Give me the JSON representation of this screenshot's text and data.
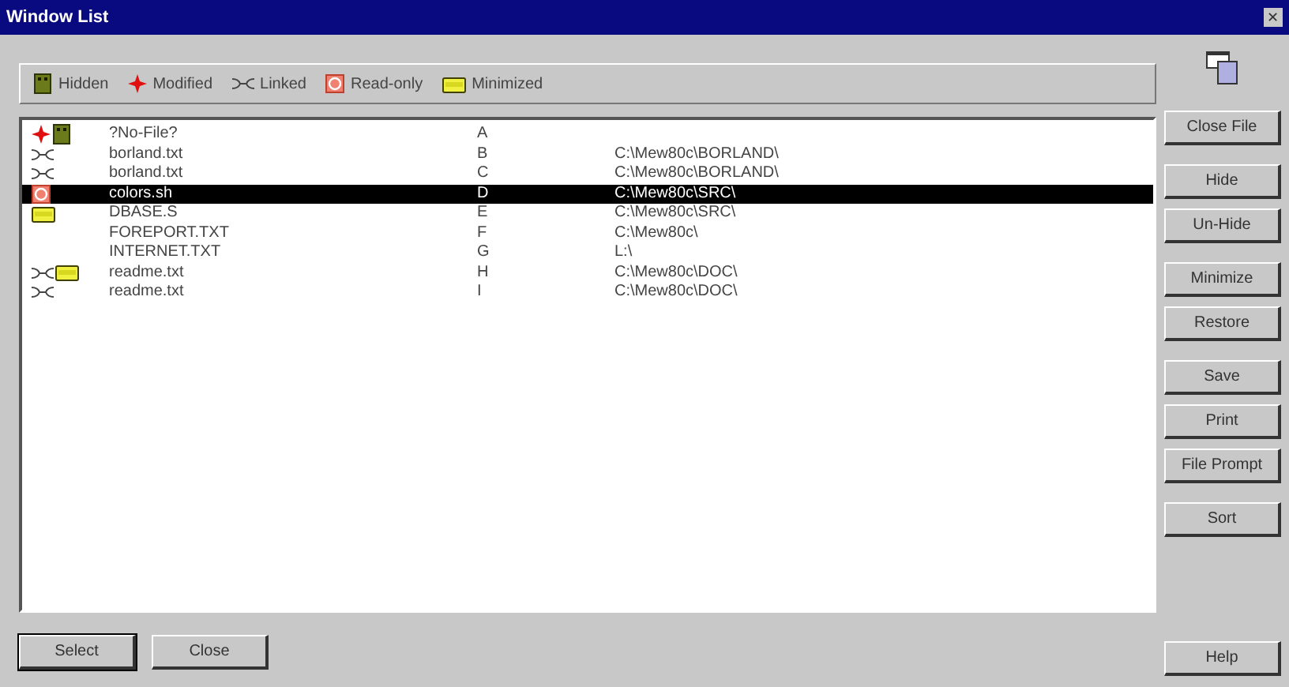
{
  "window": {
    "title": "Window List",
    "close_glyph": "✕"
  },
  "legend": [
    {
      "kind": "hidden",
      "label": "Hidden"
    },
    {
      "kind": "modified",
      "label": "Modified"
    },
    {
      "kind": "linked",
      "label": "Linked"
    },
    {
      "kind": "readonly",
      "label": "Read-only"
    },
    {
      "kind": "minimized",
      "label": "Minimized"
    }
  ],
  "rows": [
    {
      "modified": true,
      "hidden": true,
      "linked": false,
      "readonly": false,
      "minimized": false,
      "name": "?No-File?",
      "letter": "A",
      "path": "",
      "selected": false
    },
    {
      "modified": false,
      "hidden": false,
      "linked": true,
      "readonly": false,
      "minimized": false,
      "name": "borland.txt",
      "letter": "B",
      "path": "C:\\Mew80c\\BORLAND\\",
      "selected": false
    },
    {
      "modified": false,
      "hidden": false,
      "linked": true,
      "readonly": false,
      "minimized": false,
      "name": "borland.txt",
      "letter": "C",
      "path": "C:\\Mew80c\\BORLAND\\",
      "selected": false
    },
    {
      "modified": false,
      "hidden": false,
      "linked": false,
      "readonly": true,
      "minimized": false,
      "name": "colors.sh",
      "letter": "D",
      "path": "C:\\Mew80c\\SRC\\",
      "selected": true
    },
    {
      "modified": false,
      "hidden": false,
      "linked": false,
      "readonly": false,
      "minimized": true,
      "name": "DBASE.S",
      "letter": "E",
      "path": "C:\\Mew80c\\SRC\\",
      "selected": false
    },
    {
      "modified": false,
      "hidden": false,
      "linked": false,
      "readonly": false,
      "minimized": false,
      "name": "FOREPORT.TXT",
      "letter": "F",
      "path": "C:\\Mew80c\\",
      "selected": false
    },
    {
      "modified": false,
      "hidden": false,
      "linked": false,
      "readonly": false,
      "minimized": false,
      "name": "INTERNET.TXT",
      "letter": "G",
      "path": "L:\\",
      "selected": false
    },
    {
      "modified": false,
      "hidden": false,
      "linked": true,
      "readonly": false,
      "minimized": true,
      "name": "readme.txt",
      "letter": "H",
      "path": "C:\\Mew80c\\DOC\\",
      "selected": false
    },
    {
      "modified": false,
      "hidden": false,
      "linked": true,
      "readonly": false,
      "minimized": false,
      "name": "readme.txt",
      "letter": "I",
      "path": "C:\\Mew80c\\DOC\\",
      "selected": false
    }
  ],
  "side_button_groups": [
    [
      "Close File"
    ],
    [
      "Hide",
      "Un-Hide"
    ],
    [
      "Minimize",
      "Restore"
    ],
    [
      "Save",
      "Print",
      "File Prompt"
    ],
    [
      "Sort"
    ]
  ],
  "help_button": "Help",
  "bottom_buttons": [
    {
      "label": "Select",
      "default": true
    },
    {
      "label": "Close",
      "default": false
    }
  ]
}
